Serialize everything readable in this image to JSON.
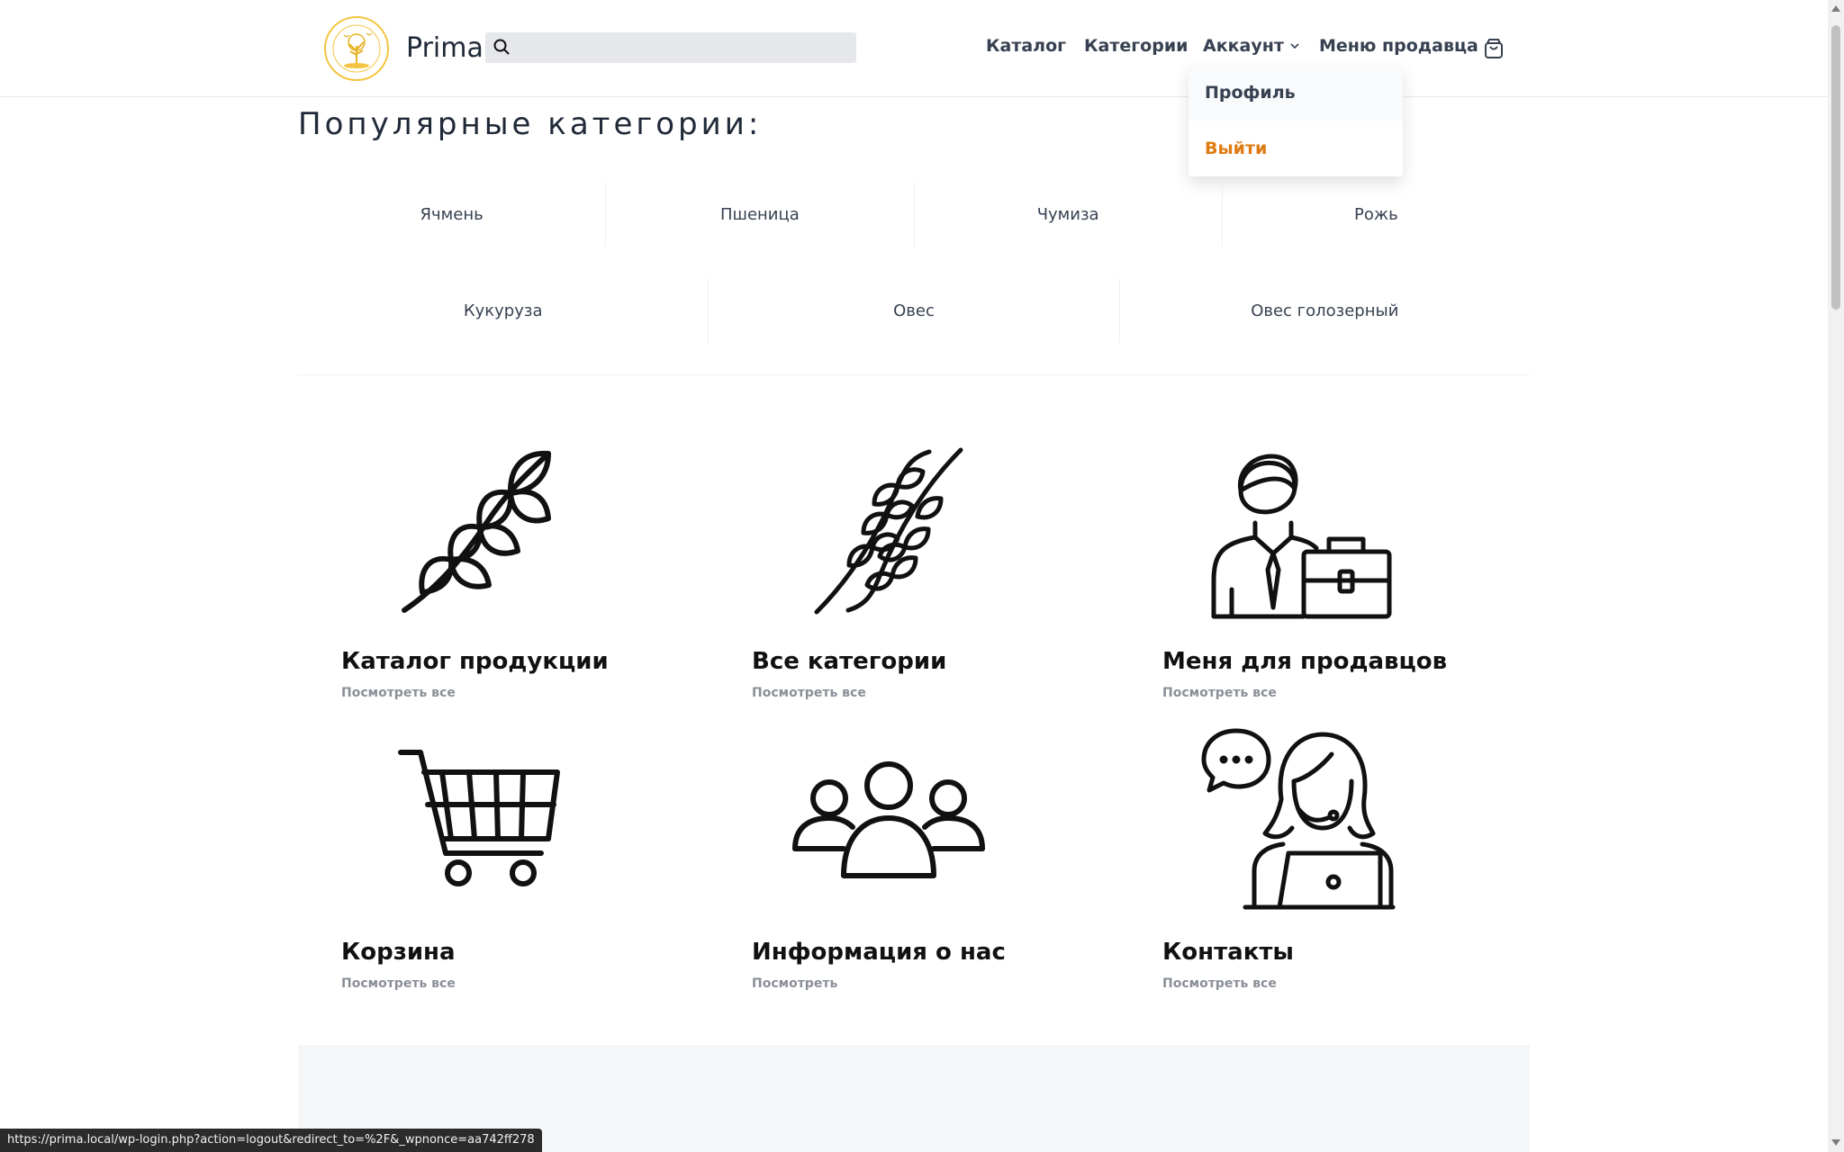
{
  "header": {
    "brand": "Prima",
    "search_placeholder": "",
    "nav": {
      "catalog": "Каталог",
      "categories": "Категории",
      "account": "Аккаунт",
      "seller_menu": "Меню продавца"
    },
    "account_dropdown": {
      "profile": "Профиль",
      "logout": "Выйти"
    }
  },
  "popular": {
    "title": "Популярные категории:",
    "row1": [
      "Ячмень",
      "Пшеница",
      "Чумиза",
      "Рожь"
    ],
    "row2": [
      "Кукуруза",
      "Овес",
      "Овес голозерный"
    ]
  },
  "features": [
    {
      "title": "Каталог продукции",
      "link": "Посмотреть все",
      "icon": "wheat-icon"
    },
    {
      "title": "Все категории",
      "link": "Посмотреть все",
      "icon": "grain-branches-icon"
    },
    {
      "title": "Меня для продавцов",
      "link": "Посмотреть все",
      "icon": "businessman-icon"
    },
    {
      "title": "Корзина",
      "link": "Посмотреть все",
      "icon": "shopping-cart-icon"
    },
    {
      "title": "Информация о нас",
      "link": "Посмотреть",
      "icon": "group-icon"
    },
    {
      "title": "Контакты",
      "link": "Посмотреть все",
      "icon": "support-operator-icon"
    }
  ],
  "status_bar_url": "https://prima.local/wp-login.php?action=logout&redirect_to=%2F&_wpnonce=aa742ff278",
  "colors": {
    "accent_orange": "#e07b12",
    "logo_yellow": "#f4c542",
    "search_bg": "#e5e7eb"
  }
}
